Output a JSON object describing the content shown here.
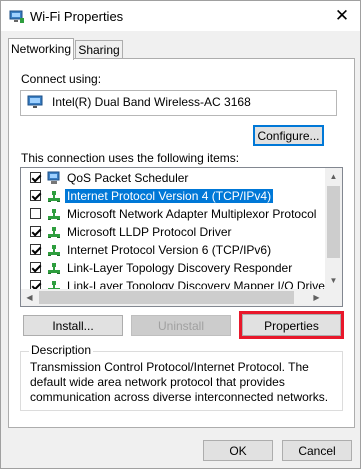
{
  "window": {
    "title": "Wi-Fi Properties",
    "close_glyph": "✕"
  },
  "tabs": [
    {
      "label": "Networking"
    },
    {
      "label": "Sharing"
    }
  ],
  "connect": {
    "label": "Connect using:",
    "adapter": "Intel(R) Dual Band Wireless-AC 3168",
    "adapter_icon": "network-adapter-icon",
    "configure_label": "Configure..."
  },
  "items": {
    "label": "This connection uses the following items:",
    "rows": [
      {
        "label": "QoS Packet Scheduler",
        "checked": true,
        "icon": "qos-icon",
        "selected": false
      },
      {
        "label": "Internet Protocol Version 4 (TCP/IPv4)",
        "checked": true,
        "icon": "protocol-icon",
        "selected": true
      },
      {
        "label": "Microsoft Network Adapter Multiplexor Protocol",
        "checked": false,
        "icon": "protocol-icon",
        "selected": false
      },
      {
        "label": "Microsoft LLDP Protocol Driver",
        "checked": true,
        "icon": "protocol-icon",
        "selected": false
      },
      {
        "label": "Internet Protocol Version 6 (TCP/IPv6)",
        "checked": true,
        "icon": "protocol-icon",
        "selected": false
      },
      {
        "label": "Link-Layer Topology Discovery Responder",
        "checked": true,
        "icon": "protocol-icon",
        "selected": false
      },
      {
        "label": "Link-Layer Topology Discovery Mapper I/O Driver",
        "checked": true,
        "icon": "protocol-icon",
        "selected": false
      }
    ]
  },
  "buttons": {
    "install": "Install...",
    "uninstall": "Uninstall",
    "properties": "Properties"
  },
  "description": {
    "title": "Description",
    "text": "Transmission Control Protocol/Internet Protocol. The default wide area network protocol that provides communication across diverse interconnected networks."
  },
  "footer": {
    "ok": "OK",
    "cancel": "Cancel"
  },
  "colors": {
    "selection": "#0078d7",
    "highlight_box": "#e8182b",
    "protocol_icon": "#2e9e3e"
  }
}
